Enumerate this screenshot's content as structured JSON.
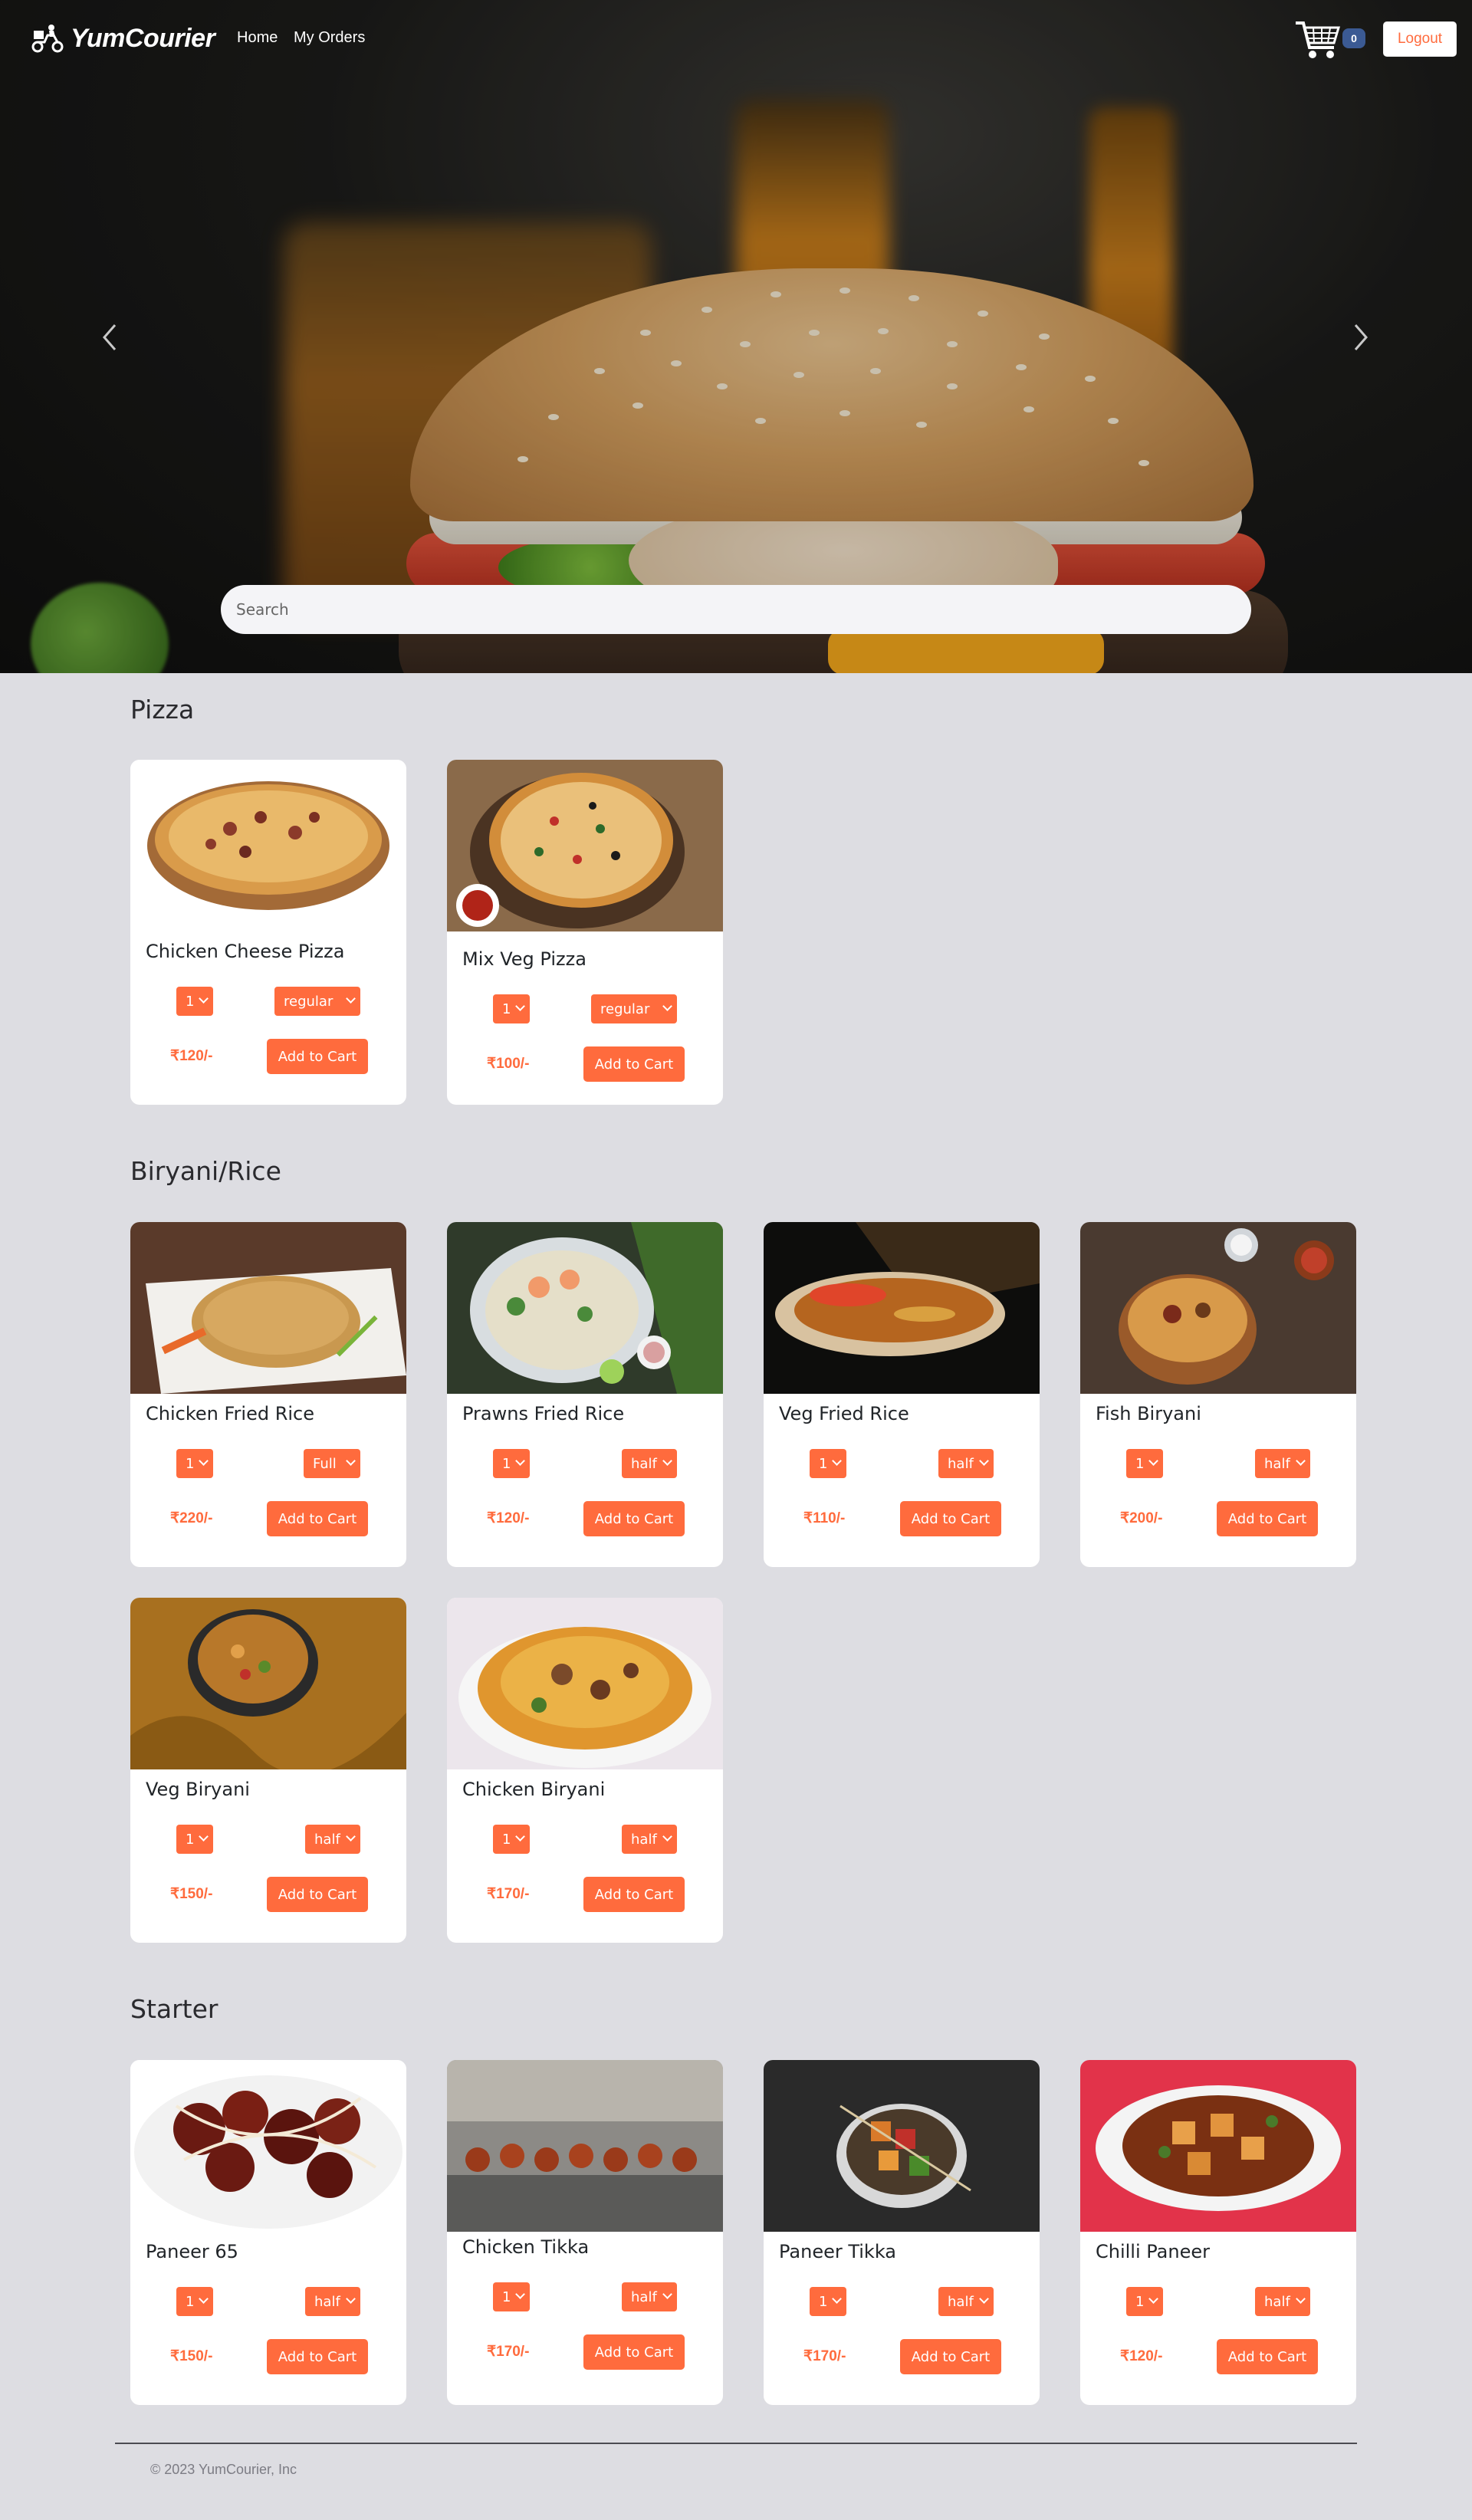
{
  "navbar": {
    "brand": "YumCourier",
    "links": [
      "Home",
      "My Orders"
    ],
    "cart_count": "0",
    "logout": "Logout"
  },
  "search": {
    "placeholder": "Search"
  },
  "sections": [
    {
      "title": "Pizza",
      "items": [
        {
          "name": "Chicken Cheese Pizza",
          "qty": "1",
          "size": "regular",
          "price": "₹120/-",
          "button": "Add to Cart"
        },
        {
          "name": "Mix Veg Pizza",
          "qty": "1",
          "size": "regular",
          "price": "₹100/-",
          "button": "Add to Cart"
        }
      ]
    },
    {
      "title": "Biryani/Rice",
      "items": [
        {
          "name": "Chicken Fried Rice",
          "qty": "1",
          "size": "Full",
          "price": "₹220/-",
          "button": "Add to Cart"
        },
        {
          "name": "Prawns Fried Rice",
          "qty": "1",
          "size": "half",
          "price": "₹120/-",
          "button": "Add to Cart"
        },
        {
          "name": "Veg Fried Rice",
          "qty": "1",
          "size": "half",
          "price": "₹110/-",
          "button": "Add to Cart"
        },
        {
          "name": "Fish Biryani",
          "qty": "1",
          "size": "half",
          "price": "₹200/-",
          "button": "Add to Cart"
        },
        {
          "name": "Veg Biryani",
          "qty": "1",
          "size": "half",
          "price": "₹150/-",
          "button": "Add to Cart"
        },
        {
          "name": "Chicken Biryani",
          "qty": "1",
          "size": "half",
          "price": "₹170/-",
          "button": "Add to Cart"
        }
      ]
    },
    {
      "title": "Starter",
      "items": [
        {
          "name": "Paneer 65",
          "qty": "1",
          "size": "half",
          "price": "₹150/-",
          "button": "Add to Cart"
        },
        {
          "name": "Chicken Tikka",
          "qty": "1",
          "size": "half",
          "price": "₹170/-",
          "button": "Add to Cart"
        },
        {
          "name": "Paneer Tikka",
          "qty": "1",
          "size": "half",
          "price": "₹170/-",
          "button": "Add to Cart"
        },
        {
          "name": "Chilli Paneer",
          "qty": "1",
          "size": "half",
          "price": "₹120/-",
          "button": "Add to Cart"
        }
      ]
    }
  ],
  "footer": {
    "text": "© 2023 YumCourier, Inc"
  },
  "colors": {
    "accent": "#ff6b3d",
    "background": "#dddde2",
    "badge": "#3b5a93"
  }
}
